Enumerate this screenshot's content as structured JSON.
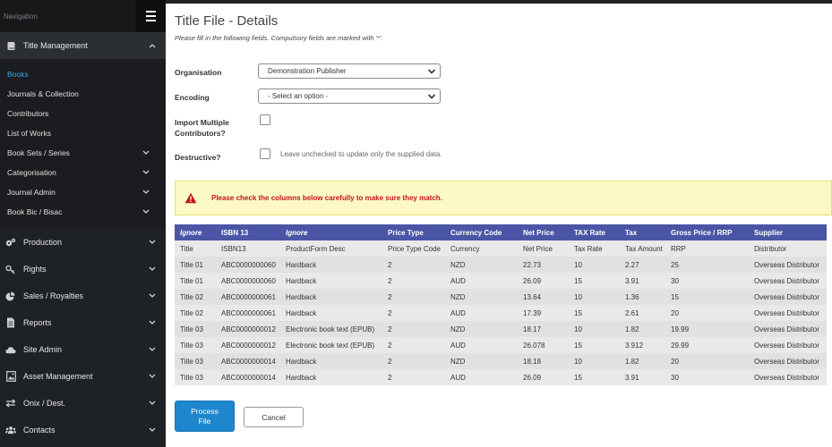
{
  "nav": {
    "title": "Navigation",
    "sections": [
      {
        "label": "Title Management",
        "icon": "book-icon",
        "expanded": true
      },
      {
        "label": "Production",
        "icon": "gears-icon"
      },
      {
        "label": "Rights",
        "icon": "key-icon"
      },
      {
        "label": "Sales / Royalties",
        "icon": "pie-chart-icon"
      },
      {
        "label": "Reports",
        "icon": "document-icon"
      },
      {
        "label": "Site Admin",
        "icon": "cloud-icon"
      },
      {
        "label": "Asset Management",
        "icon": "image-icon"
      },
      {
        "label": "Onix / Dest.",
        "icon": "exchange-icon"
      },
      {
        "label": "Contacts",
        "icon": "users-icon"
      }
    ],
    "sub_items": [
      {
        "label": "Books",
        "active": true,
        "has_children": false
      },
      {
        "label": "Journals & Collection",
        "has_children": false
      },
      {
        "label": "Contributors",
        "has_children": false
      },
      {
        "label": "List of Works",
        "has_children": false
      },
      {
        "label": "Book Sets / Series",
        "has_children": true
      },
      {
        "label": "Categorisation",
        "has_children": true
      },
      {
        "label": "Journal Admin",
        "has_children": true
      },
      {
        "label": "Book Bic / Bisac",
        "has_children": true
      }
    ]
  },
  "page": {
    "title": "Title File - Details",
    "subtitle": "Please fill in the following fields. Compulsory fields are marked with '*'."
  },
  "form": {
    "organisation_label": "Organisation",
    "organisation_value": "Demonstration Publisher",
    "encoding_label": "Encoding",
    "encoding_value": "- Select an option -",
    "import_label_line1": "Import Multiple",
    "import_label_line2": "Contributors?",
    "destructive_label": "Destructive?",
    "destructive_hint": "Leave unchecked to update only the supplied data."
  },
  "alert": {
    "text": "Please check the columns below carefully to make sure they match."
  },
  "table": {
    "headers": [
      "Ignore",
      "ISBN 13",
      "Ignore",
      "Price Type",
      "Currency Code",
      "Net Price",
      "TAX Rate",
      "Tax",
      "Gross Price / RRP",
      "Supplier"
    ],
    "rows": [
      [
        "Title",
        "ISBN13",
        "ProductForm Desc",
        "Price Type Code",
        "Currency",
        "Net Price",
        "Tax Rate",
        "Tax Amount",
        "RRP",
        "Distributor"
      ],
      [
        "Title 01",
        "ABC0000000060",
        "Hardback",
        "2",
        "NZD",
        "22.73",
        "10",
        "2.27",
        "25",
        "Overseas Distributor"
      ],
      [
        "Title 01",
        "ABC0000000060",
        "Hardback",
        "2",
        "AUD",
        "26.09",
        "15",
        "3.91",
        "30",
        "Overseas Distributor"
      ],
      [
        "Title 02",
        "ABC0000000061",
        "Hardback",
        "2",
        "NZD",
        "13.64",
        "10",
        "1.36",
        "15",
        "Overseas Distributor"
      ],
      [
        "Title 02",
        "ABC0000000061",
        "Hardback",
        "2",
        "AUD",
        "17.39",
        "15",
        "2.61",
        "20",
        "Overseas Distributor"
      ],
      [
        "Title 03",
        "ABC0000000012",
        "Electronic book text (EPUB)",
        "2",
        "NZD",
        "18.17",
        "10",
        "1.82",
        "19.99",
        "Overseas Distributor"
      ],
      [
        "Title 03",
        "ABC0000000012",
        "Electronic book text (EPUB)",
        "2",
        "AUD",
        "26.078",
        "15",
        "3.912",
        "29.99",
        "Overseas Distributor"
      ],
      [
        "Title 03",
        "ABC0000000014",
        "Hardback",
        "2",
        "NZD",
        "18.18",
        "10",
        "1.82",
        "20",
        "Overseas Distributor"
      ],
      [
        "Title 03",
        "ABC0000000014",
        "Hardback",
        "2",
        "AUD",
        "26.09",
        "15",
        "3.91",
        "30",
        "Overseas Distributor"
      ]
    ]
  },
  "buttons": {
    "process_line1": "Process",
    "process_line2": "File",
    "cancel": "Cancel"
  },
  "colors": {
    "sidebar_bg": "#1f2225",
    "active_link": "#3da2e6",
    "table_header": "#4a56a5",
    "primary_button": "#1e86cd",
    "alert_bg": "#fdf9c5",
    "alert_text": "#c51515"
  }
}
